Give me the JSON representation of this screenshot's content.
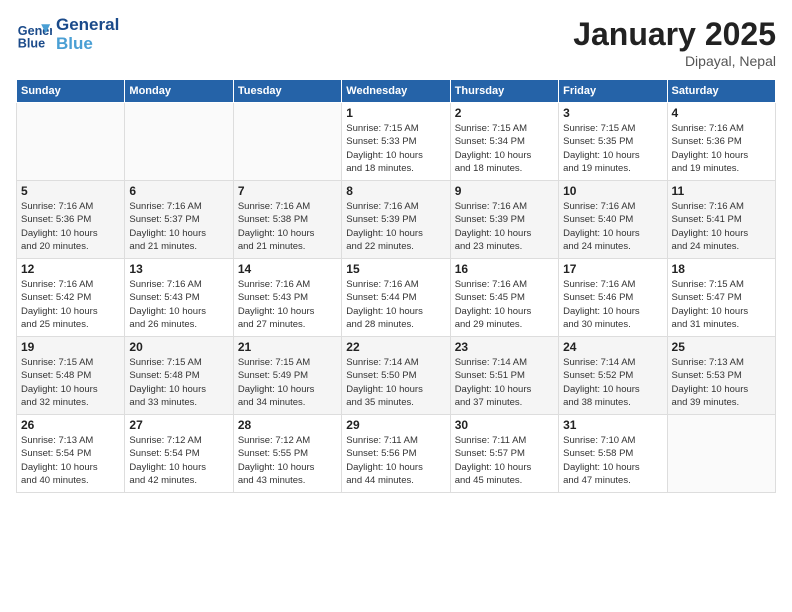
{
  "header": {
    "logo_line1": "General",
    "logo_line2": "Blue",
    "month_title": "January 2025",
    "location": "Dipayal, Nepal"
  },
  "weekdays": [
    "Sunday",
    "Monday",
    "Tuesday",
    "Wednesday",
    "Thursday",
    "Friday",
    "Saturday"
  ],
  "weeks": [
    [
      {
        "day": "",
        "info": ""
      },
      {
        "day": "",
        "info": ""
      },
      {
        "day": "",
        "info": ""
      },
      {
        "day": "1",
        "info": "Sunrise: 7:15 AM\nSunset: 5:33 PM\nDaylight: 10 hours\nand 18 minutes."
      },
      {
        "day": "2",
        "info": "Sunrise: 7:15 AM\nSunset: 5:34 PM\nDaylight: 10 hours\nand 18 minutes."
      },
      {
        "day": "3",
        "info": "Sunrise: 7:15 AM\nSunset: 5:35 PM\nDaylight: 10 hours\nand 19 minutes."
      },
      {
        "day": "4",
        "info": "Sunrise: 7:16 AM\nSunset: 5:36 PM\nDaylight: 10 hours\nand 19 minutes."
      }
    ],
    [
      {
        "day": "5",
        "info": "Sunrise: 7:16 AM\nSunset: 5:36 PM\nDaylight: 10 hours\nand 20 minutes."
      },
      {
        "day": "6",
        "info": "Sunrise: 7:16 AM\nSunset: 5:37 PM\nDaylight: 10 hours\nand 21 minutes."
      },
      {
        "day": "7",
        "info": "Sunrise: 7:16 AM\nSunset: 5:38 PM\nDaylight: 10 hours\nand 21 minutes."
      },
      {
        "day": "8",
        "info": "Sunrise: 7:16 AM\nSunset: 5:39 PM\nDaylight: 10 hours\nand 22 minutes."
      },
      {
        "day": "9",
        "info": "Sunrise: 7:16 AM\nSunset: 5:39 PM\nDaylight: 10 hours\nand 23 minutes."
      },
      {
        "day": "10",
        "info": "Sunrise: 7:16 AM\nSunset: 5:40 PM\nDaylight: 10 hours\nand 24 minutes."
      },
      {
        "day": "11",
        "info": "Sunrise: 7:16 AM\nSunset: 5:41 PM\nDaylight: 10 hours\nand 24 minutes."
      }
    ],
    [
      {
        "day": "12",
        "info": "Sunrise: 7:16 AM\nSunset: 5:42 PM\nDaylight: 10 hours\nand 25 minutes."
      },
      {
        "day": "13",
        "info": "Sunrise: 7:16 AM\nSunset: 5:43 PM\nDaylight: 10 hours\nand 26 minutes."
      },
      {
        "day": "14",
        "info": "Sunrise: 7:16 AM\nSunset: 5:43 PM\nDaylight: 10 hours\nand 27 minutes."
      },
      {
        "day": "15",
        "info": "Sunrise: 7:16 AM\nSunset: 5:44 PM\nDaylight: 10 hours\nand 28 minutes."
      },
      {
        "day": "16",
        "info": "Sunrise: 7:16 AM\nSunset: 5:45 PM\nDaylight: 10 hours\nand 29 minutes."
      },
      {
        "day": "17",
        "info": "Sunrise: 7:16 AM\nSunset: 5:46 PM\nDaylight: 10 hours\nand 30 minutes."
      },
      {
        "day": "18",
        "info": "Sunrise: 7:15 AM\nSunset: 5:47 PM\nDaylight: 10 hours\nand 31 minutes."
      }
    ],
    [
      {
        "day": "19",
        "info": "Sunrise: 7:15 AM\nSunset: 5:48 PM\nDaylight: 10 hours\nand 32 minutes."
      },
      {
        "day": "20",
        "info": "Sunrise: 7:15 AM\nSunset: 5:48 PM\nDaylight: 10 hours\nand 33 minutes."
      },
      {
        "day": "21",
        "info": "Sunrise: 7:15 AM\nSunset: 5:49 PM\nDaylight: 10 hours\nand 34 minutes."
      },
      {
        "day": "22",
        "info": "Sunrise: 7:14 AM\nSunset: 5:50 PM\nDaylight: 10 hours\nand 35 minutes."
      },
      {
        "day": "23",
        "info": "Sunrise: 7:14 AM\nSunset: 5:51 PM\nDaylight: 10 hours\nand 37 minutes."
      },
      {
        "day": "24",
        "info": "Sunrise: 7:14 AM\nSunset: 5:52 PM\nDaylight: 10 hours\nand 38 minutes."
      },
      {
        "day": "25",
        "info": "Sunrise: 7:13 AM\nSunset: 5:53 PM\nDaylight: 10 hours\nand 39 minutes."
      }
    ],
    [
      {
        "day": "26",
        "info": "Sunrise: 7:13 AM\nSunset: 5:54 PM\nDaylight: 10 hours\nand 40 minutes."
      },
      {
        "day": "27",
        "info": "Sunrise: 7:12 AM\nSunset: 5:54 PM\nDaylight: 10 hours\nand 42 minutes."
      },
      {
        "day": "28",
        "info": "Sunrise: 7:12 AM\nSunset: 5:55 PM\nDaylight: 10 hours\nand 43 minutes."
      },
      {
        "day": "29",
        "info": "Sunrise: 7:11 AM\nSunset: 5:56 PM\nDaylight: 10 hours\nand 44 minutes."
      },
      {
        "day": "30",
        "info": "Sunrise: 7:11 AM\nSunset: 5:57 PM\nDaylight: 10 hours\nand 45 minutes."
      },
      {
        "day": "31",
        "info": "Sunrise: 7:10 AM\nSunset: 5:58 PM\nDaylight: 10 hours\nand 47 minutes."
      },
      {
        "day": "",
        "info": ""
      }
    ]
  ]
}
